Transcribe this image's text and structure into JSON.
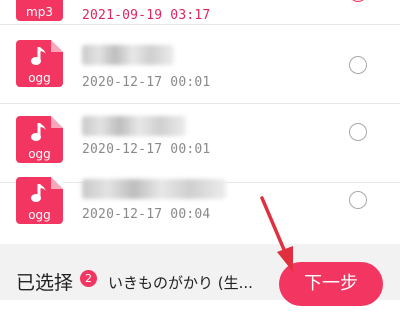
{
  "files": [
    {
      "ext": "mp3",
      "date": "2021-09-19 03:17",
      "date_active": true
    },
    {
      "ext": "ogg",
      "date": "2020-12-17 00:01",
      "date_active": false
    },
    {
      "ext": "ogg",
      "date": "2020-12-17 00:01",
      "date_active": false
    },
    {
      "ext": "ogg",
      "date": "2020-12-17 00:04",
      "date_active": false
    }
  ],
  "bottom_bar": {
    "selected_label": "已选择",
    "selected_count": "2",
    "selected_song": "いきものがかり (生...",
    "next_label": "下一步"
  },
  "colors": {
    "accent": "#f23561",
    "annotation_arrow": "#e03040"
  }
}
